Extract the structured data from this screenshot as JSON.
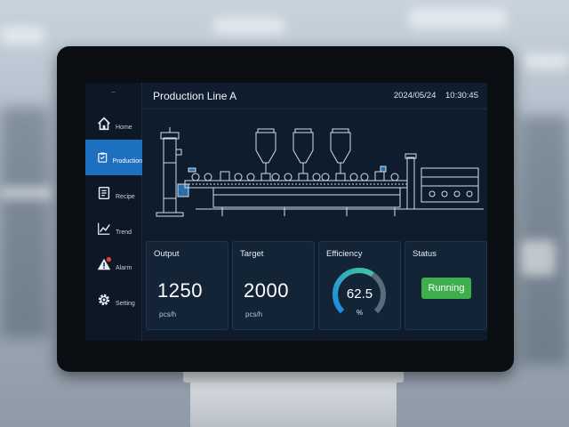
{
  "header": {
    "title": "Production Line A",
    "date": "2024/05/24",
    "time": "10:30:45"
  },
  "sidebar": {
    "top_mark": "–",
    "active_color": "#1d6fbf",
    "items": [
      {
        "label": "Home",
        "icon": "home-icon"
      },
      {
        "label": "Production",
        "icon": "production-icon",
        "active": true
      },
      {
        "label": "Recipe",
        "icon": "recipe-icon"
      },
      {
        "label": "Trend",
        "icon": "trend-icon"
      },
      {
        "label": "Alarm",
        "icon": "alarm-icon"
      },
      {
        "label": "Setting",
        "icon": "gear-icon"
      }
    ]
  },
  "cards": {
    "output": {
      "label": "Output",
      "value": "1250",
      "unit": "pcs/h"
    },
    "target": {
      "label": "Target",
      "value": "2000",
      "unit": "pcs/h"
    },
    "efficiency": {
      "label": "Efficiency",
      "value": "62.5",
      "unit": "%",
      "fraction": 0.625,
      "color_start": "#1e88e5",
      "color_end": "#43c59e"
    },
    "status": {
      "label": "Status",
      "value": "Running",
      "color": "#3fae4c"
    }
  },
  "colors": {
    "screen_bg": "#0f1b2b",
    "line_drawing": "#cfe0f0"
  }
}
